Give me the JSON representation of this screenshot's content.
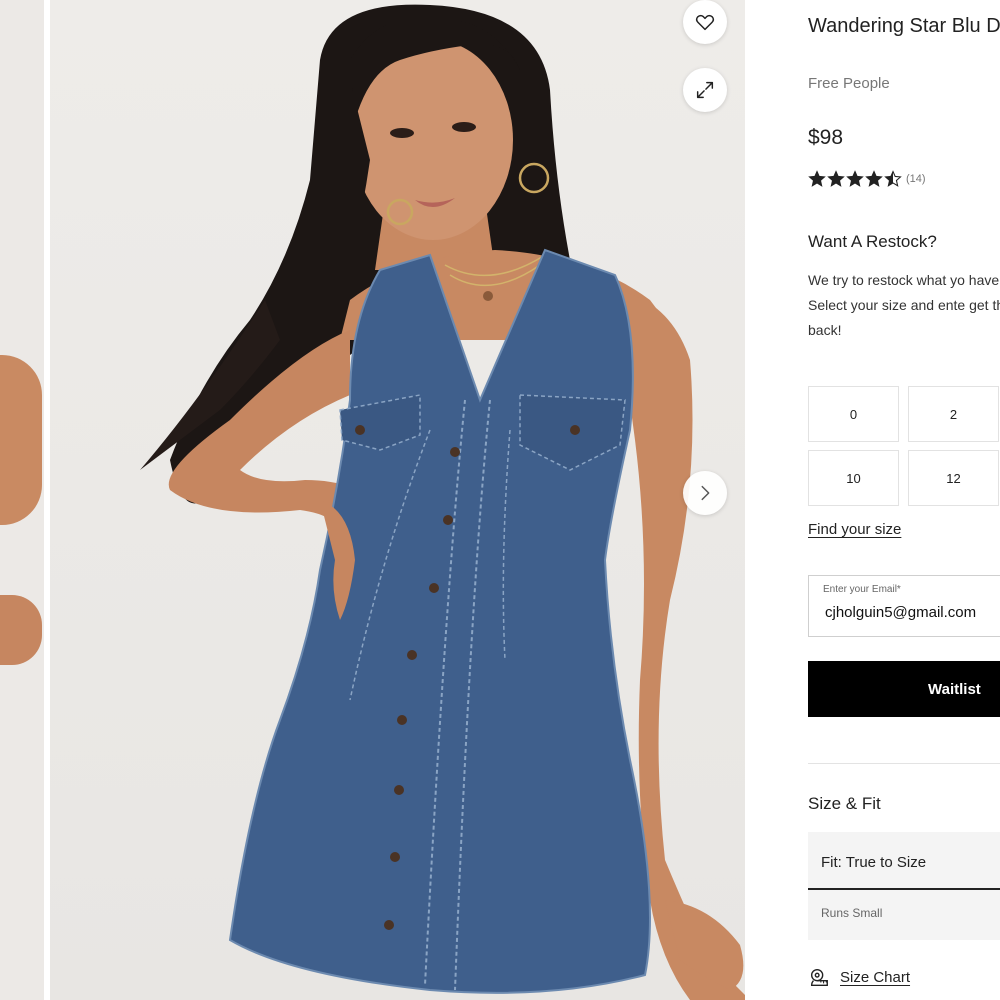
{
  "gallery": {
    "wishlist_icon": "heart-icon",
    "expand_icon": "expand-icon",
    "next_icon": "chevron-right-icon"
  },
  "product": {
    "title": "Wandering Star Blu Dress",
    "brand": "Free People",
    "price": "$98",
    "rating": {
      "value": 4.5,
      "max": 5,
      "count": "(14)"
    }
  },
  "restock": {
    "title": "Want A Restock?",
    "text": "We try to restock what yo have it!",
    "text2": "Select your size and ente get this style back!",
    "sizes": [
      "0",
      "2",
      "10",
      "12"
    ]
  },
  "find_size": "Find your size",
  "email": {
    "label": "Enter your Email*",
    "value": "cjholguin5@gmail.com"
  },
  "waitlist_label": "Waitlist",
  "size_fit": {
    "title": "Size & Fit",
    "fit": "Fit: True to Size",
    "note": "Runs Small"
  },
  "size_chart": {
    "label": "Size Chart",
    "icon": "ruler-icon"
  },
  "colors": {
    "button": "#000000",
    "denim": "#3f5f8c",
    "skin": "#c98a62",
    "hair": "#1c1614"
  }
}
